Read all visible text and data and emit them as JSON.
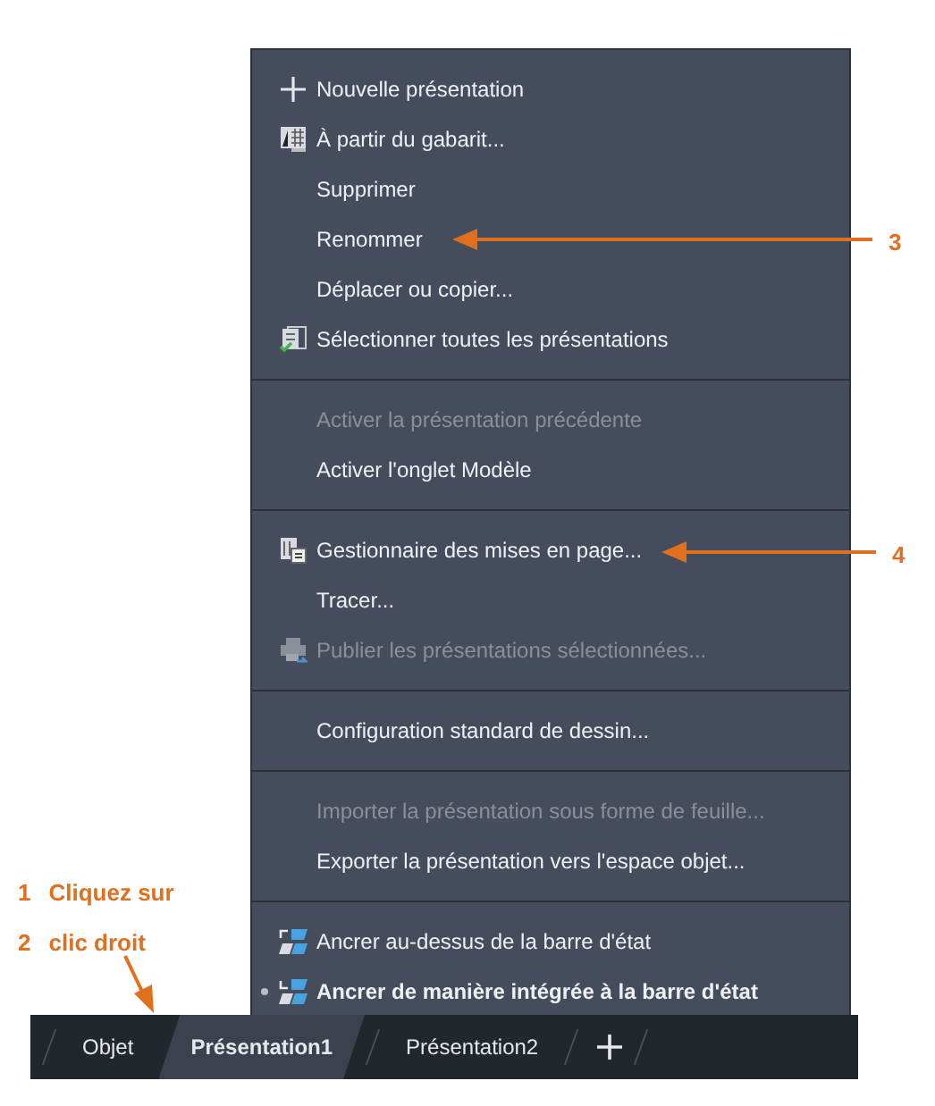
{
  "menu": {
    "sections": [
      {
        "items": [
          {
            "label": "Nouvelle présentation",
            "kind": "plus",
            "disabled": false
          },
          {
            "label": "À partir du gabarit...",
            "kind": "template",
            "disabled": false
          },
          {
            "label": "Supprimer",
            "disabled": false
          },
          {
            "label": "Renommer",
            "disabled": false
          },
          {
            "label": "Déplacer ou copier...",
            "disabled": false
          },
          {
            "label": "Sélectionner toutes les présentations",
            "kind": "select-all",
            "disabled": false
          }
        ]
      },
      {
        "items": [
          {
            "label": "Activer la présentation précédente",
            "disabled": true
          },
          {
            "label": "Activer l'onglet Modèle",
            "disabled": false
          }
        ]
      },
      {
        "items": [
          {
            "label": "Gestionnaire des mises en page...",
            "kind": "page-setup",
            "disabled": false
          },
          {
            "label": "Tracer...",
            "disabled": false
          },
          {
            "label": "Publier les présentations sélectionnées...",
            "kind": "printer",
            "disabled": true
          }
        ]
      },
      {
        "items": [
          {
            "label": "Configuration standard de dessin...",
            "disabled": false
          }
        ]
      },
      {
        "items": [
          {
            "label": "Importer la présentation sous forme de feuille...",
            "disabled": true
          },
          {
            "label": "Exporter la présentation vers l'espace objet...",
            "disabled": false
          }
        ]
      },
      {
        "items": [
          {
            "label": "Ancrer au-dessus de la barre d'état",
            "kind": "dock-above",
            "disabled": false,
            "selected": false
          },
          {
            "label": "Ancrer de manière intégrée à la barre d'état",
            "kind": "dock-inline",
            "disabled": false,
            "selected": true
          }
        ]
      }
    ]
  },
  "tab_bar": {
    "tabs": [
      {
        "label": "Objet",
        "selected": false
      },
      {
        "label": "Présentation1",
        "selected": true
      },
      {
        "label": "Présentation2",
        "selected": false
      }
    ]
  },
  "callouts": [
    {
      "number": "3"
    },
    {
      "number": "4"
    }
  ],
  "steps": [
    {
      "number": "1",
      "text": "Cliquez sur"
    },
    {
      "number": "2",
      "text": "clic droit"
    }
  ]
}
